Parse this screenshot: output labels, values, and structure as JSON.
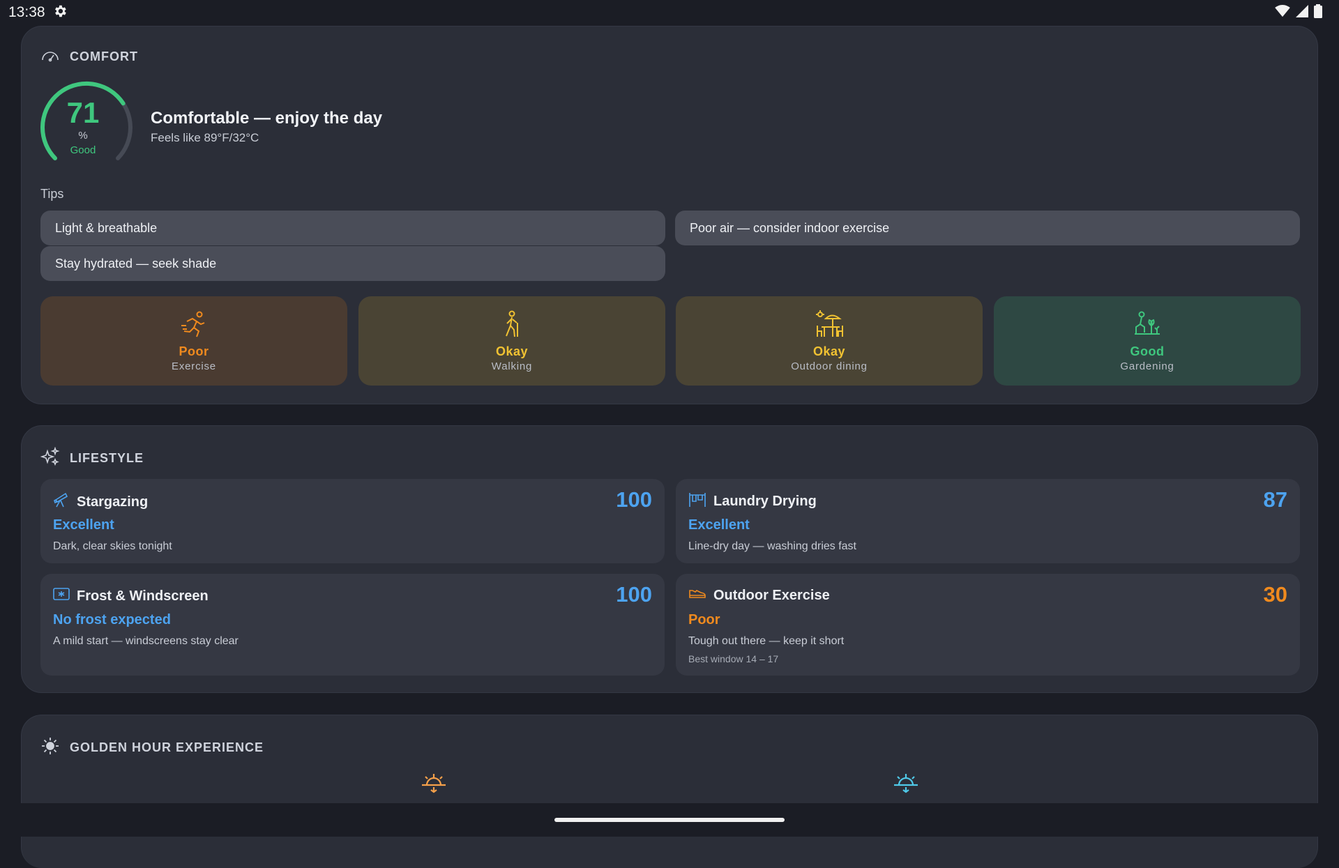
{
  "status_bar": {
    "time": "13:38",
    "icons": [
      "settings-icon",
      "wifi-icon",
      "signal-icon",
      "battery-icon"
    ]
  },
  "comfort": {
    "header": "COMFORT",
    "gauge_value": "71",
    "gauge_unit": "%",
    "gauge_level": "Good",
    "gauge_fraction": 0.71,
    "title": "Comfortable — enjoy the day",
    "feels_like": "Feels like 89°F/32°C",
    "tips_label": "Tips",
    "tips": [
      "Light & breathable",
      "Poor air — consider indoor exercise",
      "Stay hydrated — seek shade"
    ],
    "activities": [
      {
        "status": "Poor",
        "name": "Exercise",
        "icon": "running-icon"
      },
      {
        "status": "Okay",
        "name": "Walking",
        "icon": "walking-icon"
      },
      {
        "status": "Okay",
        "name": "Outdoor dining",
        "icon": "outdoor-dining-icon"
      },
      {
        "status": "Good",
        "name": "Gardening",
        "icon": "gardening-icon"
      }
    ]
  },
  "lifestyle": {
    "header": "LIFESTYLE",
    "items": [
      {
        "title": "Stargazing",
        "score": "100",
        "rating": "Excellent",
        "desc": "Dark, clear skies tonight",
        "extra": "",
        "icon": "telescope-icon"
      },
      {
        "title": "Laundry Drying",
        "score": "87",
        "rating": "Excellent",
        "desc": "Line-dry day — washing dries fast",
        "extra": "",
        "icon": "laundry-icon"
      },
      {
        "title": "Frost & Windscreen",
        "score": "100",
        "rating": "No frost expected",
        "desc": "A mild start — windscreens stay clear",
        "extra": "",
        "icon": "windscreen-icon"
      },
      {
        "title": "Outdoor Exercise",
        "score": "30",
        "rating": "Poor",
        "desc": "Tough out there — keep it short",
        "extra": "Best window 14 – 17",
        "icon": "shoe-icon"
      }
    ]
  },
  "golden_hour": {
    "header": "GOLDEN HOUR EXPERIENCE",
    "icons": [
      "sunrise-icon",
      "sunset-icon"
    ]
  },
  "colors": {
    "good": "#3fc77e",
    "okay": "#f1c232",
    "poor": "#f08a1e",
    "blue": "#4da3f0"
  }
}
